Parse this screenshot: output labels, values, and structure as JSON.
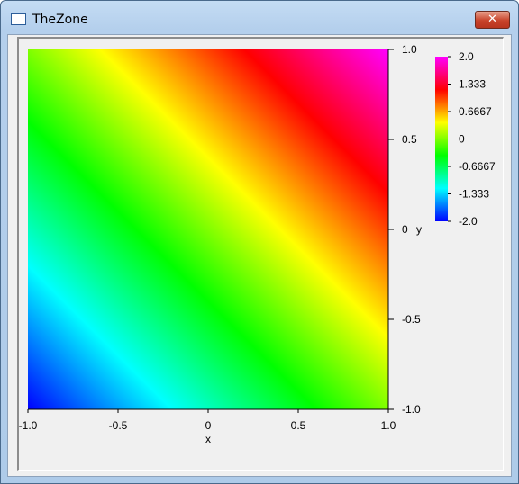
{
  "window": {
    "title": "TheZone",
    "close_glyph": "✕"
  },
  "icons": {
    "app": "window-icon",
    "close": "close-icon"
  },
  "chart_data": {
    "type": "heatmap",
    "function": "z = x + y",
    "x": {
      "label": "x",
      "range": [
        -1.0,
        1.0
      ],
      "ticks": [
        "-1.0",
        "-0.5",
        "0",
        "0.5",
        "1.0"
      ]
    },
    "y": {
      "label": "y",
      "range": [
        -1.0,
        1.0
      ],
      "ticks": [
        "1.0",
        "0.5",
        "0",
        "-0.5",
        "-1.0"
      ]
    },
    "z_range": [
      -2.0,
      2.0
    ],
    "colorbar": {
      "ticks": [
        "2.0",
        "1.333",
        "0.6667",
        "0",
        "-0.6667",
        "-1.333",
        "-2.0"
      ],
      "colors": [
        "#ff00ff",
        "#ff0000",
        "#ffff00",
        "#00ff00",
        "#00ffff",
        "#0000ff"
      ]
    }
  }
}
